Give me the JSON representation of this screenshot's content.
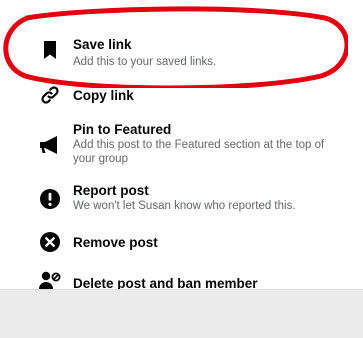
{
  "menu": {
    "items": [
      {
        "label": "Save link",
        "description": "Add this to your saved links.",
        "icon": "bookmark-icon"
      },
      {
        "label": "Copy link",
        "description": "",
        "icon": "link-icon"
      },
      {
        "label": "Pin to Featured",
        "description": "Add this post to the Featured section at the top of your group",
        "icon": "megaphone-icon"
      },
      {
        "label": "Report post",
        "description": "We won't let Susan know who reported this.",
        "icon": "exclamation-icon"
      },
      {
        "label": "Remove post",
        "description": "",
        "icon": "remove-circle-icon"
      },
      {
        "label": "Delete post and ban member",
        "description": "",
        "icon": "ban-member-icon"
      }
    ]
  },
  "colors": {
    "annotation_ring": "#e3000f",
    "primary_text": "#050505",
    "secondary_text": "#65676b",
    "footer_background": "#ececec"
  }
}
